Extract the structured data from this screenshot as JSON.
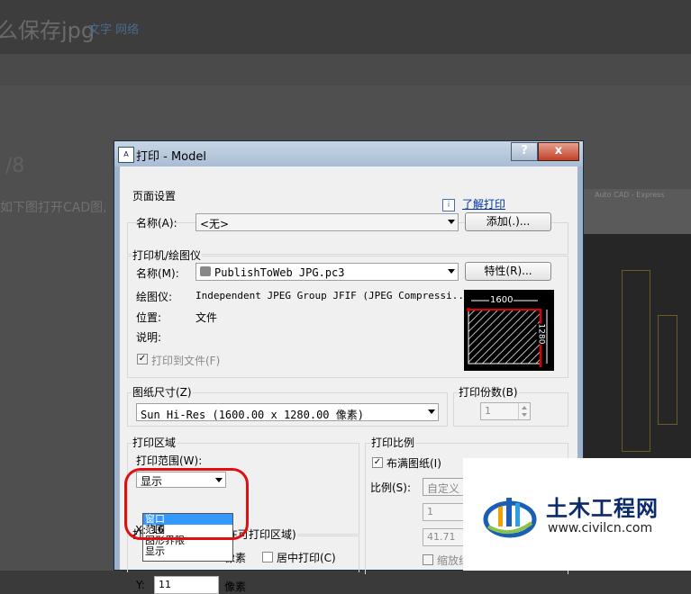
{
  "background": {
    "page_title": "么保存jpg",
    "tag": "文字 网络",
    "heading": "/8",
    "body_text": "如下图打开CAD图,",
    "cad_title": "Auto CAD - Express"
  },
  "dialog": {
    "title": "打印 - Model",
    "help_label": "?",
    "close_label": "x",
    "learn_link": "了解打印",
    "page_setup": {
      "title": "页面设置",
      "name_label": "名称(A):",
      "name_value": "<无>",
      "add_button": "添加(.)..."
    },
    "printer": {
      "title": "打印机/绘图仪",
      "name_label": "名称(M):",
      "name_value": "PublishToWeb JPG.pc3",
      "props_button": "特性(R)...",
      "plotter_label": "绘图仪:",
      "plotter_value": "Independent JPEG Group JFIF (JPEG Compressi...",
      "location_label": "位置:",
      "location_value": "文件",
      "desc_label": "说明:",
      "print_to_file": "打印到文件(F)",
      "preview_width": "1600",
      "preview_height": "1280"
    },
    "paper_size": {
      "title": "图纸尺寸(Z)",
      "value": "Sun Hi-Res (1600.00 x 1280.00 像素)"
    },
    "copies": {
      "title": "打印份数(B)",
      "value": "1"
    },
    "plot_area": {
      "title": "打印区域",
      "range_label": "打印范围(W):",
      "range_value": "显示",
      "options": [
        "窗口",
        "范围",
        "图形界限",
        "显示"
      ],
      "selected_index": 0
    },
    "plot_offset": {
      "title_fragment": "打",
      "hint": "在可打印区域)",
      "x_label": "X:",
      "x_value": "16",
      "x_unit": "像素",
      "center_label": "居中打印(C)",
      "y_label": "Y:",
      "y_value": "11",
      "y_unit": "像素"
    },
    "plot_scale": {
      "title": "打印比例",
      "fit_label": "布满图纸(I)",
      "scale_label": "比例(S):",
      "scale_value": "自定义",
      "val1": "1",
      "val2": "41.71",
      "scale_lw_label": "缩放线"
    }
  },
  "watermark": {
    "name": "土木工程网",
    "url": "www.civilcn.com"
  }
}
